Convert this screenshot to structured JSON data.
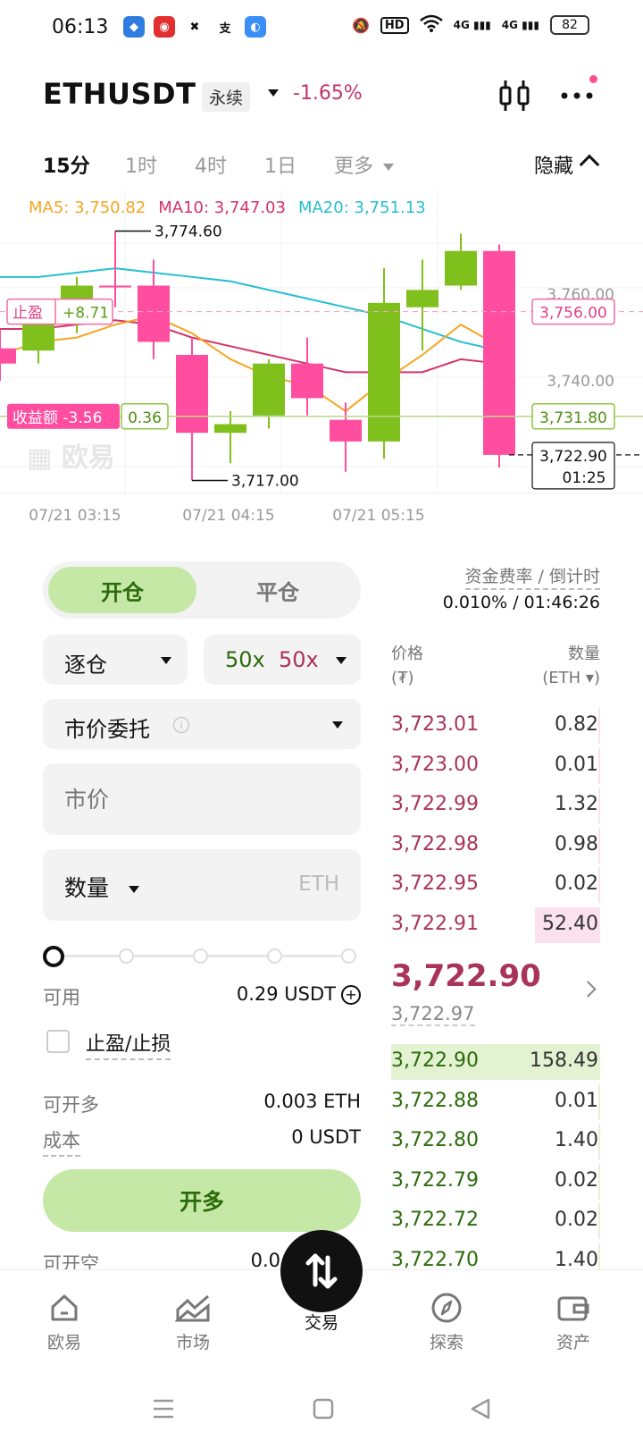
{
  "status_bar": {
    "time": "06:13",
    "battery": "82",
    "network_1": "4G",
    "network_2": "4G",
    "hd_badge": "HD"
  },
  "header": {
    "pair": "ETHUSDT",
    "contract_type": "永续",
    "change": "-1.65%"
  },
  "timeframes": {
    "tabs": [
      "15分",
      "1时",
      "4时",
      "1日",
      "更多"
    ],
    "active": "15分",
    "hide_label": "隐藏"
  },
  "chart_data": {
    "type": "candlestick",
    "ma_legend": [
      {
        "label": "MA5: 3,750.82",
        "color": "#f5a623"
      },
      {
        "label": "MA10: 3,747.03",
        "color": "#d6336c"
      },
      {
        "label": "MA20: 3,751.13",
        "color": "#26bfd0"
      }
    ],
    "y_ticks": [
      "3,760.00",
      "3,740.00"
    ],
    "x_ticks": [
      "07/21 03:15",
      "07/21 04:15",
      "07/21 05:15"
    ],
    "candles": [
      {
        "o": 3747.5,
        "h": 3752,
        "l": 3740,
        "c": 3744,
        "dir": "down"
      },
      {
        "o": 3747,
        "h": 3758,
        "l": 3744,
        "c": 3754,
        "dir": "up"
      },
      {
        "o": 3755,
        "h": 3764,
        "l": 3751,
        "c": 3762,
        "dir": "up"
      },
      {
        "o": 3762,
        "h": 3774.6,
        "l": 3757,
        "c": 3762,
        "dir": "doji"
      },
      {
        "o": 3762,
        "h": 3768,
        "l": 3745,
        "c": 3749,
        "dir": "down"
      },
      {
        "o": 3746,
        "h": 3750,
        "l": 3717,
        "c": 3728,
        "dir": "down"
      },
      {
        "o": 3728,
        "h": 3733,
        "l": 3721,
        "c": 3730,
        "dir": "up"
      },
      {
        "o": 3732,
        "h": 3745,
        "l": 3729,
        "c": 3744,
        "dir": "up"
      },
      {
        "o": 3744,
        "h": 3750,
        "l": 3732,
        "c": 3736,
        "dir": "down"
      },
      {
        "o": 3731,
        "h": 3735,
        "l": 3719,
        "c": 3726,
        "dir": "down"
      },
      {
        "o": 3726,
        "h": 3766,
        "l": 3722,
        "c": 3758,
        "dir": "up"
      },
      {
        "o": 3757,
        "h": 3768,
        "l": 3747,
        "c": 3761,
        "dir": "up"
      },
      {
        "o": 3762,
        "h": 3774,
        "l": 3761,
        "c": 3770,
        "dir": "up"
      },
      {
        "o": 3770,
        "h": 3771.5,
        "l": 3720,
        "c": 3722.9,
        "dir": "down"
      }
    ],
    "ma5": [
      3746,
      3749,
      3750,
      3753,
      3755,
      3751,
      3745,
      3741,
      3739,
      3733,
      3740,
      3746,
      3753,
      3748
    ],
    "ma10": [
      3752,
      3752,
      3753,
      3754,
      3753,
      3750,
      3748,
      3746,
      3744,
      3742,
      3742,
      3742,
      3745,
      3744
    ],
    "ma20": [
      3764,
      3764,
      3765,
      3766,
      3765,
      3764,
      3763,
      3761,
      3759,
      3757,
      3755,
      3752,
      3749,
      3747
    ],
    "ylim": [
      3714,
      3778
    ],
    "max_label": "3,774.60",
    "min_label": "3,717.00",
    "take_profit": {
      "label": "止盈",
      "pnl": "+8.71",
      "price": "3,756.00",
      "value": 3756
    },
    "position": {
      "label": "收益额 -3.56",
      "size": "0.36",
      "price": "3,731.80",
      "value": 3731.8
    },
    "current": {
      "price": "3,722.90",
      "countdown": "01:25",
      "value": 3722.9
    },
    "watermark": "欧易"
  },
  "trade_panel": {
    "open_label": "开仓",
    "close_label": "平仓",
    "margin_mode": "逐仓",
    "leverage_long": "50x",
    "leverage_short": "50x",
    "order_type": "市价委托",
    "price_placeholder": "市价",
    "qty_label": "数量",
    "qty_unit": "ETH",
    "available_label": "可用",
    "available_value": "0.29 USDT",
    "tpsl_label": "止盈/止损",
    "max_long_label": "可开多",
    "max_long_value": "0.003 ETH",
    "cost_label": "成本",
    "cost_value": "0 USDT",
    "buy_button": "开多",
    "max_short_label": "可开空",
    "max_short_value": "0.0"
  },
  "order_book": {
    "funding_label": "资金费率 / 倒计时",
    "funding_value": "0.010% / 01:46:26",
    "price_header_1": "价格",
    "price_header_2": "(₮)",
    "qty_header_1": "数量",
    "qty_header_2": "(ETH ▾)",
    "asks": [
      {
        "price": "3,723.01",
        "qty": "0.82",
        "depth": 0.01
      },
      {
        "price": "3,723.00",
        "qty": "0.01",
        "depth": 0.0
      },
      {
        "price": "3,722.99",
        "qty": "1.32",
        "depth": 0.01
      },
      {
        "price": "3,722.98",
        "qty": "0.98",
        "depth": 0.01
      },
      {
        "price": "3,722.95",
        "qty": "0.02",
        "depth": 0.0
      },
      {
        "price": "3,722.91",
        "qty": "52.40",
        "depth": 0.31
      }
    ],
    "last_price": "3,722.90",
    "mark_price": "3,722.97",
    "bids": [
      {
        "price": "3,722.90",
        "qty": "158.49",
        "depth": 1.0
      },
      {
        "price": "3,722.88",
        "qty": "0.01",
        "depth": 0.0
      },
      {
        "price": "3,722.80",
        "qty": "1.40",
        "depth": 0.01
      },
      {
        "price": "3,722.79",
        "qty": "0.02",
        "depth": 0.0
      },
      {
        "price": "3,722.72",
        "qty": "0.02",
        "depth": 0.0
      },
      {
        "price": "3,722.70",
        "qty": "1.40",
        "depth": 0.01
      }
    ]
  },
  "bottom_nav": {
    "items": [
      "欧易",
      "市场",
      "交易",
      "探索",
      "资产"
    ],
    "active": "交易"
  },
  "colors": {
    "up": "#7fc01c",
    "down": "#ff4ea0",
    "accent_green": "#c6e8a6",
    "accent_red_text": "#a8345a"
  }
}
